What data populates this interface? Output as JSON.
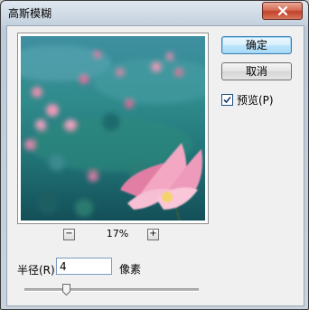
{
  "window": {
    "title": "高斯模糊"
  },
  "buttons": {
    "ok": "确定",
    "cancel": "取消"
  },
  "preview_toggle": {
    "label": "预览(P)",
    "checked": true
  },
  "zoom": {
    "minus": "−",
    "plus": "+",
    "value": "17%"
  },
  "radius": {
    "label": "半径(R):",
    "value": "4",
    "unit": "像素",
    "slider_fraction": 0.24
  },
  "colors": {
    "accent": "#3c7fb1",
    "title_bar": "#c4d2df",
    "close_red": "#c2412a"
  }
}
